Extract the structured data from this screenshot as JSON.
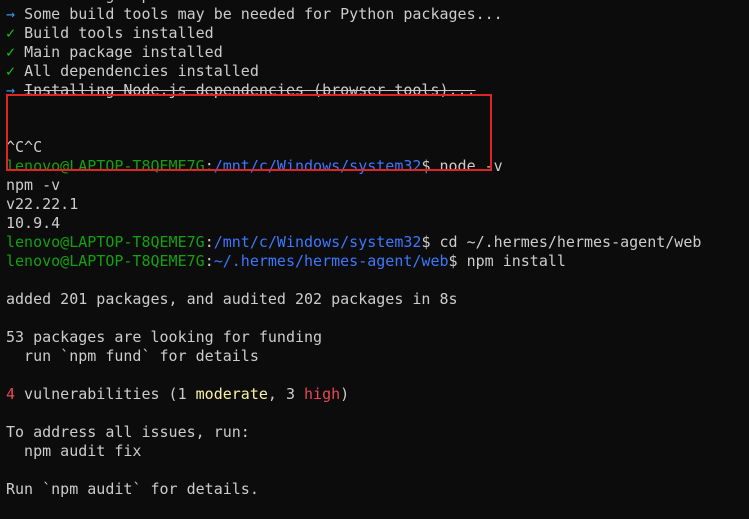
{
  "terminal": {
    "lines": [
      [
        {
          "t": "✓ ",
          "c": "c-check"
        },
        {
          "t": "Installing dependencies...",
          "c": "c-gray"
        }
      ],
      [
        {
          "t": "→ ",
          "c": "c-arrow"
        },
        {
          "t": "Some build tools may be needed for Python packages...",
          "c": "c-gray"
        }
      ],
      [
        {
          "t": "✓ ",
          "c": "c-check"
        },
        {
          "t": "Build tools installed",
          "c": "c-gray"
        }
      ],
      [
        {
          "t": "✓ ",
          "c": "c-check"
        },
        {
          "t": "Main package installed",
          "c": "c-gray"
        }
      ],
      [
        {
          "t": "✓ ",
          "c": "c-check"
        },
        {
          "t": "All dependencies installed",
          "c": "c-gray"
        }
      ],
      [
        {
          "t": "→ ",
          "c": "c-arrow"
        },
        {
          "t": "Installing Node.js dependencies (browser tools)...",
          "c": "c-gray strike"
        }
      ],
      [],
      [],
      [
        {
          "t": "^C^C",
          "c": "c-gray"
        }
      ],
      [
        {
          "t": "lenovo@LAPTOP-T8QEME7G",
          "c": "c-green"
        },
        {
          "t": ":",
          "c": "c-gray"
        },
        {
          "t": "/mnt/c/Windows/system32",
          "c": "c-blue"
        },
        {
          "t": "$ node -v",
          "c": "c-gray"
        }
      ],
      [
        {
          "t": "npm -v",
          "c": "c-gray"
        }
      ],
      [
        {
          "t": "v22.22.1",
          "c": "c-gray"
        }
      ],
      [
        {
          "t": "10.9.4",
          "c": "c-gray"
        }
      ],
      [
        {
          "t": "lenovo@LAPTOP-T8QEME7G",
          "c": "c-green"
        },
        {
          "t": ":",
          "c": "c-gray"
        },
        {
          "t": "/mnt/c/Windows/system32",
          "c": "c-blue"
        },
        {
          "t": "$ cd ~/.hermes/hermes-agent/web",
          "c": "c-gray"
        }
      ],
      [
        {
          "t": "lenovo@LAPTOP-T8QEME7G",
          "c": "c-green"
        },
        {
          "t": ":",
          "c": "c-gray"
        },
        {
          "t": "~/.hermes/hermes-agent/web",
          "c": "c-blue"
        },
        {
          "t": "$ npm install",
          "c": "c-gray"
        }
      ],
      [],
      [
        {
          "t": "added 201 packages, and audited 202 packages in 8s",
          "c": "c-gray"
        }
      ],
      [],
      [
        {
          "t": "53 packages are looking for funding",
          "c": "c-gray"
        }
      ],
      [
        {
          "t": "  run `npm fund` for details",
          "c": "c-gray"
        }
      ],
      [],
      [
        {
          "t": "4",
          "c": "c-red"
        },
        {
          "t": " vulnerabilities (1 ",
          "c": "c-gray"
        },
        {
          "t": "moderate",
          "c": "c-yellow"
        },
        {
          "t": ", 3 ",
          "c": "c-gray"
        },
        {
          "t": "high",
          "c": "c-red"
        },
        {
          "t": ")",
          "c": "c-gray"
        }
      ],
      [],
      [
        {
          "t": "To address all issues, run:",
          "c": "c-gray"
        }
      ],
      [
        {
          "t": "  npm audit fix",
          "c": "c-gray"
        }
      ],
      [],
      [
        {
          "t": "Run `npm audit` for details.",
          "c": "c-gray"
        }
      ]
    ]
  },
  "colors": {
    "background": "#0c0c0c",
    "text": "#cccccc",
    "prompt_user": "#13a10e",
    "prompt_path": "#3b78ff",
    "highlight_box": "#e02424",
    "moderate": "#f9f1a5",
    "high": "#e74856"
  }
}
